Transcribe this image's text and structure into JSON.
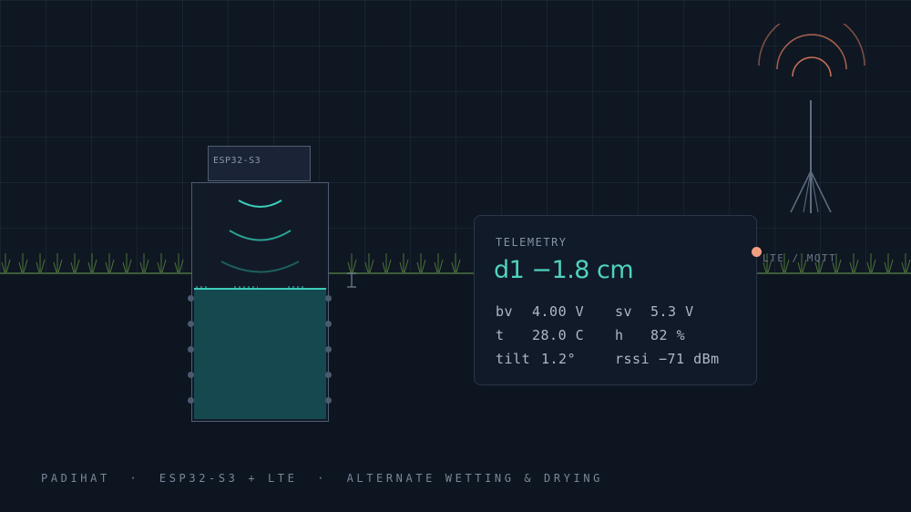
{
  "device": {
    "module_label": "ESP32-S3"
  },
  "telemetry": {
    "title": "TELEMETRY",
    "reading": "d1 −1.8 cm",
    "metrics": [
      {
        "label": "bv",
        "value": "4.00 V"
      },
      {
        "label": "sv",
        "value": "5.3 V"
      },
      {
        "label": "t",
        "value": "28.0 C"
      },
      {
        "label": "h",
        "value": "82 %"
      },
      {
        "label": "tilt",
        "value": "1.2°"
      },
      {
        "label": "rssi",
        "value": "−71 dBm"
      }
    ]
  },
  "uplink": {
    "label": "LTE / MQTT"
  },
  "footer": {
    "caption": "PADIHAT  ·  ESP32-S3 + LTE  ·  ALTERNATE WETTING & DRYING"
  },
  "colors": {
    "background": "#0d1520",
    "water": "#15484f",
    "water_surface": "#3ccdb9",
    "reading_accent": "#4fd1bf",
    "signal_arcs": "#d77a5e",
    "status_dot": "#f0a082",
    "grass": "#5d8a3f"
  }
}
